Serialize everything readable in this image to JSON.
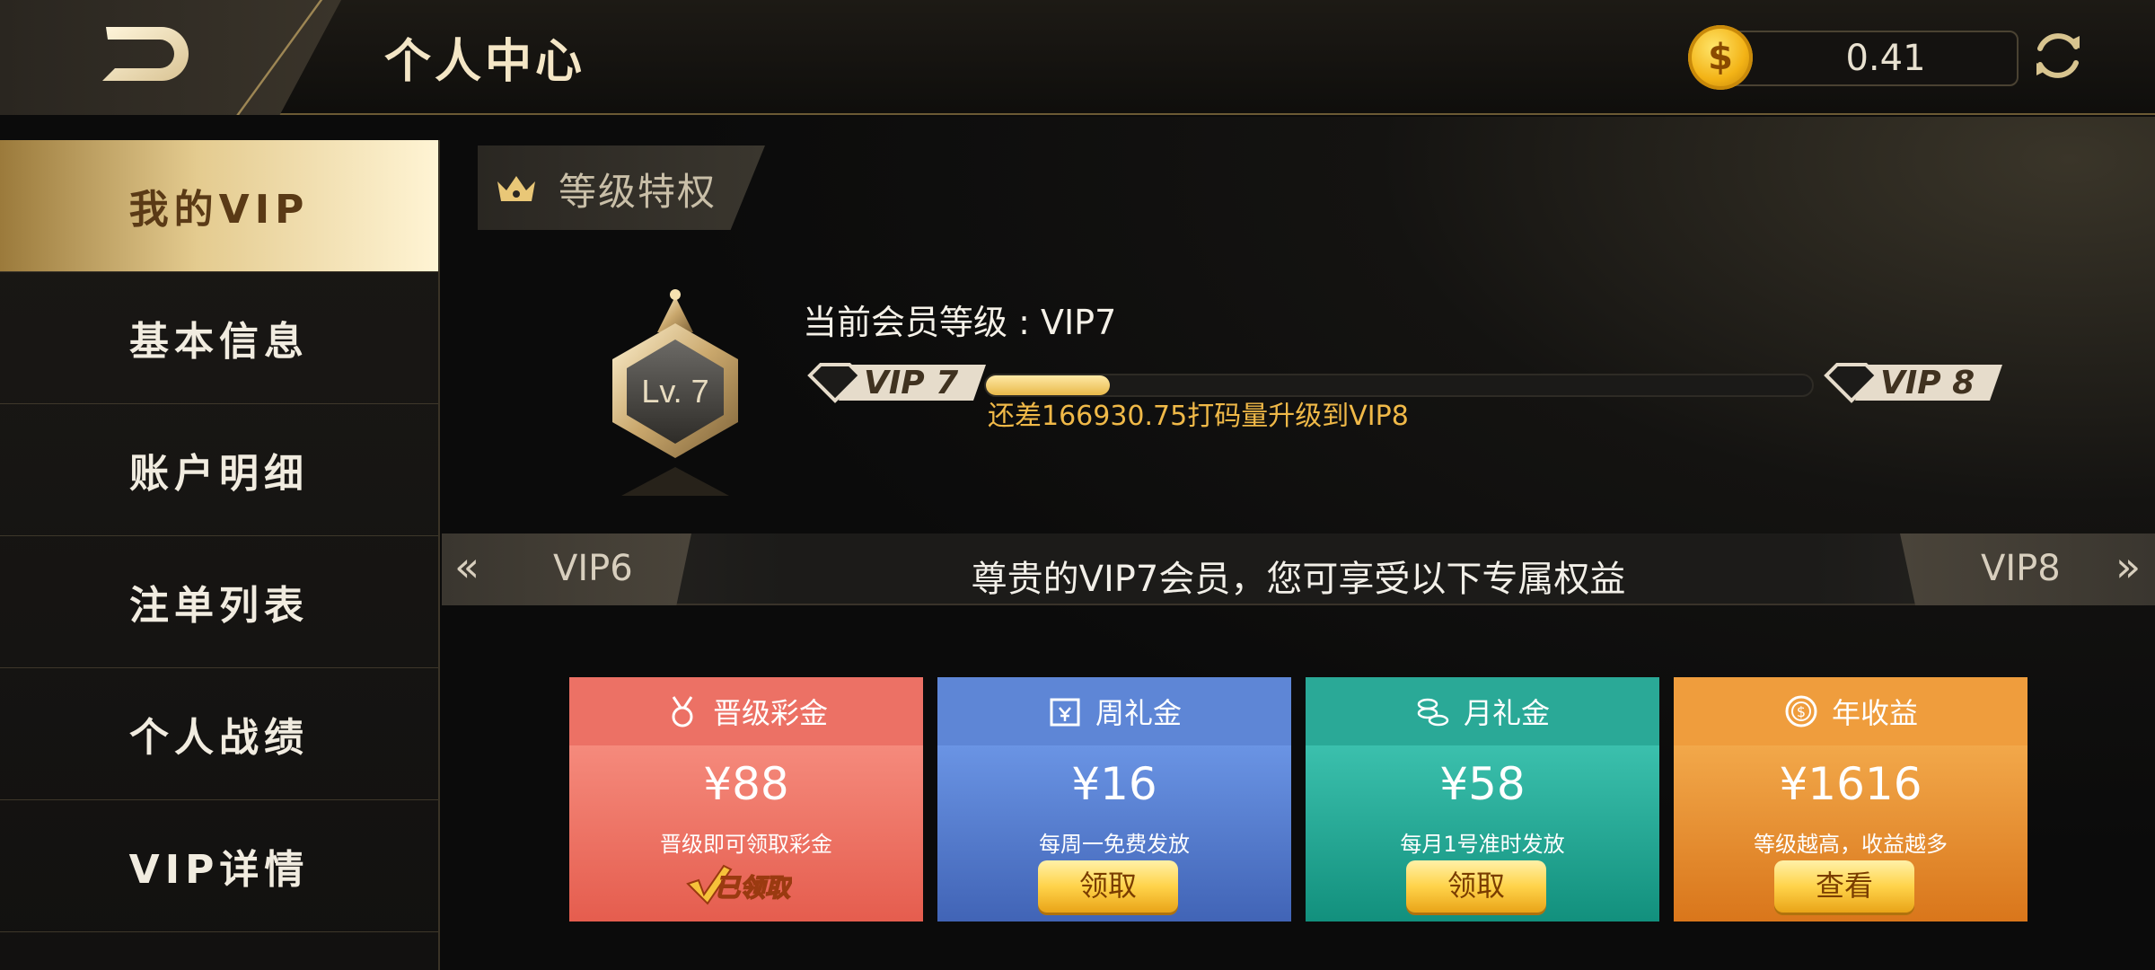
{
  "header": {
    "title": "个人中心",
    "balance": "0.41",
    "coin_symbol": "$"
  },
  "sidebar": {
    "items": [
      {
        "label": "我的VIP",
        "active": true
      },
      {
        "label": "基本信息"
      },
      {
        "label": "账户明细"
      },
      {
        "label": "注单列表"
      },
      {
        "label": "个人战绩"
      },
      {
        "label": "VIP详情"
      }
    ]
  },
  "section": {
    "title": "等级特权"
  },
  "vip": {
    "badge_text": "Lv. 7",
    "current_level_text": "当前会员等级 : VIP7",
    "from_label": "VIP 7",
    "to_label": "VIP 8",
    "progress": 0.15,
    "progress_hint": "还差166930.75打码量升级到VIP8"
  },
  "banner": {
    "prev_level": "VIP6",
    "next_level": "VIP8",
    "prev_chevron": "«",
    "next_chevron": "»",
    "text": "尊贵的VIP7会员，您可享受以下专属权益"
  },
  "cards": [
    {
      "title": "晋级彩金",
      "amount": "¥88",
      "desc": "晋级即可领取彩金",
      "status": "已领取",
      "icon": "medal-icon"
    },
    {
      "title": "周礼金",
      "amount": "¥16",
      "desc": "每周一免费发放",
      "button": "领取",
      "icon": "calendar-yen-icon"
    },
    {
      "title": "月礼金",
      "amount": "¥58",
      "desc": "每月1号准时发放",
      "button": "领取",
      "icon": "coins-stack-icon"
    },
    {
      "title": "年收益",
      "amount": "¥1616",
      "desc": "等级越高，收益越多",
      "button": "查看",
      "icon": "dollar-coin-icon"
    }
  ],
  "colors": {
    "gold": "#e9b94a",
    "card1": "#ec7165",
    "card2": "#5e86d6",
    "card3": "#2aa997",
    "card4": "#ef9d3d"
  }
}
